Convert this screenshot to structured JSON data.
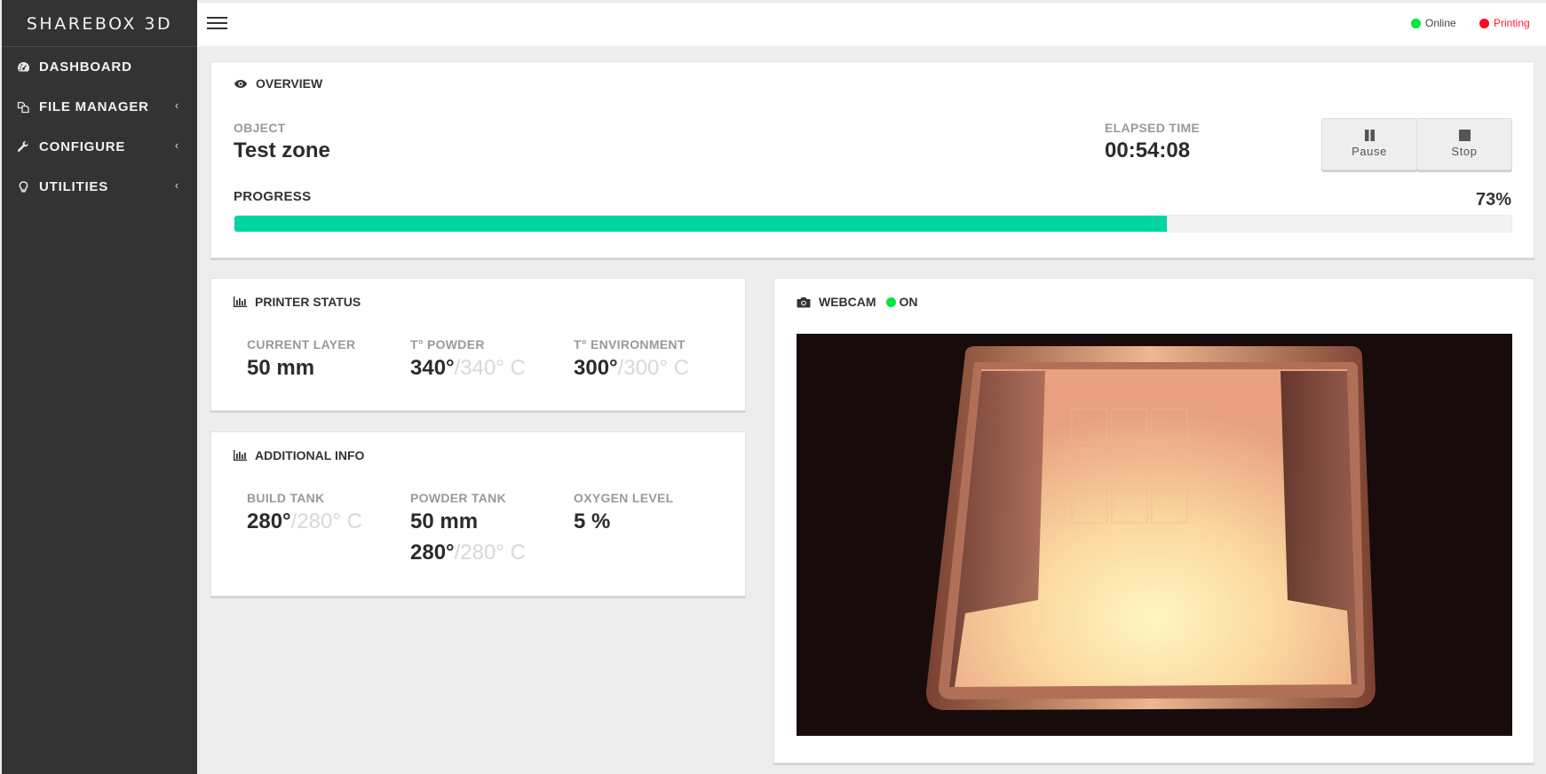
{
  "app": {
    "brand": "SHAREBOX 3D"
  },
  "sidebar": {
    "items": [
      {
        "label": "DASHBOARD",
        "icon": "dashboard-icon",
        "has_submenu": false
      },
      {
        "label": "FILE MANAGER",
        "icon": "files-icon",
        "has_submenu": true
      },
      {
        "label": "CONFIGURE",
        "icon": "wrench-icon",
        "has_submenu": true
      },
      {
        "label": "UTILITIES",
        "icon": "lightbulb-icon",
        "has_submenu": true
      }
    ],
    "chevron": "‹"
  },
  "topbar": {
    "menu_icon": "hamburger-icon",
    "status": [
      {
        "label": "Online",
        "color": "#00e63a"
      },
      {
        "label": "Printing",
        "color": "#ff0a1e"
      }
    ]
  },
  "overview": {
    "title": "OVERVIEW",
    "icon": "eye-icon",
    "object_label": "OBJECT",
    "object_value": "Test zone",
    "elapsed_label": "ELAPSED TIME",
    "elapsed_value": "00:54:08",
    "buttons": {
      "pause": "Pause",
      "stop": "Stop"
    },
    "progress_label": "PROGRESS",
    "progress_text": "73%",
    "progress_fraction": 0.73,
    "progress_color": "#00d5a1"
  },
  "printer_status": {
    "title": "PRINTER STATUS",
    "icon": "bar-chart-icon",
    "fields": [
      {
        "label": "CURRENT LAYER",
        "value": "50 mm",
        "target": ""
      },
      {
        "label": "T° POWDER",
        "value": "340°",
        "target": "/340° C"
      },
      {
        "label": "T° ENVIRONMENT",
        "value": "300°",
        "target": "/300° C"
      }
    ]
  },
  "additional_info": {
    "title": "ADDITIONAL INFO",
    "icon": "bar-chart-icon",
    "build_tank": {
      "label": "BUILD TANK",
      "value": "280°",
      "target": "/280° C"
    },
    "powder_tank": {
      "label": "POWDER TANK",
      "value": "50 mm",
      "value2": "280°",
      "target2": "/280° C"
    },
    "oxygen": {
      "label": "OXYGEN LEVEL",
      "value": "5 %"
    }
  },
  "webcam": {
    "title": "WEBCAM",
    "icon": "camera-icon",
    "state": "ON",
    "state_color": "#00e63a"
  }
}
